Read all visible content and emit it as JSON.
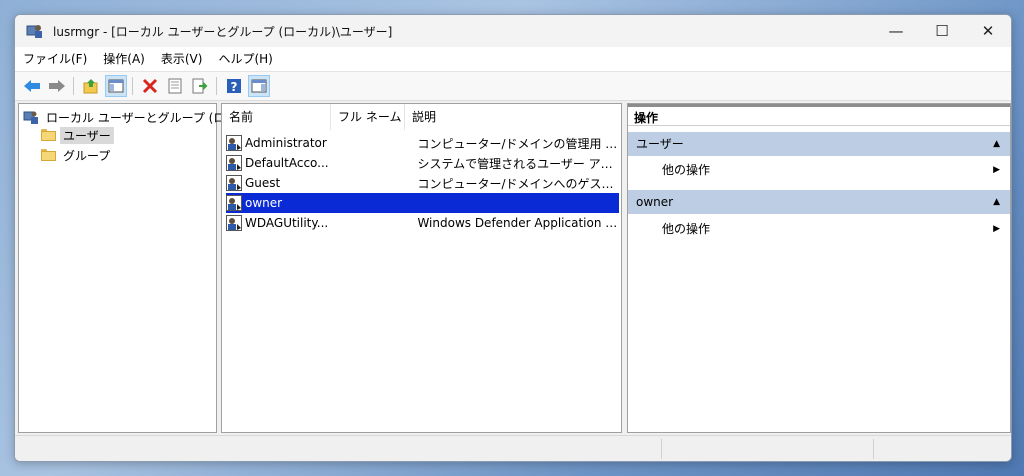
{
  "window": {
    "title": "lusrmgr - [ローカル ユーザーとグループ (ローカル)\\ユーザー]",
    "minimize": "—",
    "maximize": "☐",
    "close": "✕"
  },
  "menu": [
    "ファイル(F)",
    "操作(A)",
    "表示(V)",
    "ヘルプ(H)"
  ],
  "toolbar": [
    "back-icon",
    "forward-icon",
    "up-folder-icon",
    "show-hide-tree-icon",
    "delete-icon",
    "properties-icon",
    "export-list-icon",
    "help-icon",
    "show-hide-action-pane-icon"
  ],
  "tree": {
    "root": "ローカル ユーザーとグループ (ローカル)",
    "items": [
      "ユーザー",
      "グループ"
    ],
    "selected": "ユーザー"
  },
  "list": {
    "columns": [
      "名前",
      "フル ネーム",
      "説明"
    ],
    "rows": [
      {
        "name": "Administrator",
        "fullname": "",
        "desc": "コンピューター/ドメインの管理用 (ビルトイ..."
      },
      {
        "name": "DefaultAcco...",
        "fullname": "",
        "desc": "システムで管理されるユーザー アカウント..."
      },
      {
        "name": "Guest",
        "fullname": "",
        "desc": "コンピューター/ドメインへのゲスト アクセス..."
      },
      {
        "name": "owner",
        "fullname": "",
        "desc": ""
      },
      {
        "name": "WDAGUtility...",
        "fullname": "",
        "desc": "Windows Defender Application Gu..."
      }
    ],
    "selected_row": "owner"
  },
  "actions": {
    "header": "操作",
    "sections": [
      {
        "title": "ユーザー",
        "item": "他の操作"
      },
      {
        "title": "owner",
        "item": "他の操作"
      }
    ]
  },
  "colors": {
    "selection": "#0a2ad6",
    "section_bg": "#bccde4"
  }
}
